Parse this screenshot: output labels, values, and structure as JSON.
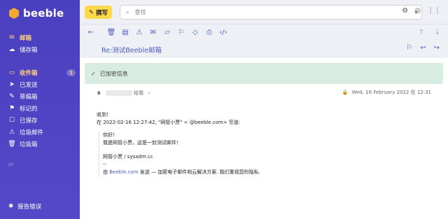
{
  "app": {
    "name": "beeble"
  },
  "sidebar": {
    "top_items": [
      {
        "label": "邮箱",
        "icon": "mail-icon",
        "active": true
      },
      {
        "label": "储存箱",
        "icon": "cloud-icon",
        "active": false
      }
    ],
    "folders": [
      {
        "label": "收件箱",
        "icon": "inbox-icon",
        "active": true,
        "count": "1"
      },
      {
        "label": "已发送",
        "icon": "send-icon",
        "active": false
      },
      {
        "label": "草稿箱",
        "icon": "draft-icon",
        "active": false
      },
      {
        "label": "标记的",
        "icon": "bookmark-icon",
        "active": false
      },
      {
        "label": "已保存",
        "icon": "archive-icon",
        "active": false
      },
      {
        "label": "垃圾邮件",
        "icon": "spam-icon",
        "active": false
      },
      {
        "label": "垃圾箱",
        "icon": "trash-icon",
        "active": false
      }
    ],
    "report_label": "报告错误"
  },
  "topbar": {
    "compose_label": "撰写",
    "search_placeholder": "查找"
  },
  "message": {
    "subject": "Re:测试Beeble邮箱",
    "encrypted_label": "已加密信息",
    "sender_initial": "s",
    "to_label": "给我",
    "date": "Wed, 16 February 2022 在 12:31",
    "body_lines": [
      "收到！",
      "在 2022-02-16 12:27:42, \"网管小贾\" <          @beeble.com> 写道:"
    ],
    "quote": {
      "line1": "你好!",
      "line2": "我是网管小贾，这是一封测试邮件！",
      "line3": "网管小贾 / sysadm.cc",
      "line4": "--",
      "footer_prefix": "由 ",
      "footer_link": "Beeble.com",
      "footer_suffix": " 发送 — 加密电子邮件和云解决方案. 我们重视您的隐私."
    }
  },
  "colors": {
    "sidebar": "#4a3fbf",
    "accent": "#4a5cc0",
    "compose": "#ffd94a",
    "encrypted_banner": "#d8ece2"
  }
}
